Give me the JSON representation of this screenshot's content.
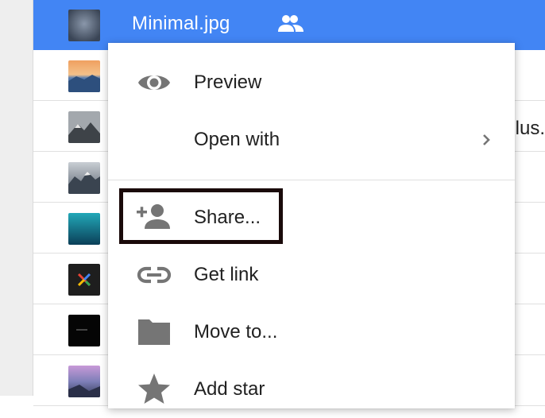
{
  "file_list": {
    "selected_row": {
      "name": "Minimal.jpg",
      "shared_icon": "people-icon"
    },
    "truncated_text": "lus."
  },
  "context_menu": {
    "items": [
      {
        "label": "Preview",
        "icon": "eye-icon"
      },
      {
        "label": "Open with",
        "icon": "none",
        "submenu_icon": "chevron-right-icon"
      },
      {
        "label": "Share...",
        "icon": "person-add-icon"
      },
      {
        "label": "Get link",
        "icon": "link-icon"
      },
      {
        "label": "Move to...",
        "icon": "folder-icon"
      },
      {
        "label": "Add star",
        "icon": "star-icon"
      }
    ],
    "highlighted_item": "Share..."
  },
  "colors": {
    "selection": "#4285f4",
    "menu_icon": "#757575",
    "menu_text": "#212121",
    "highlight_border": "#1a0a0a"
  }
}
